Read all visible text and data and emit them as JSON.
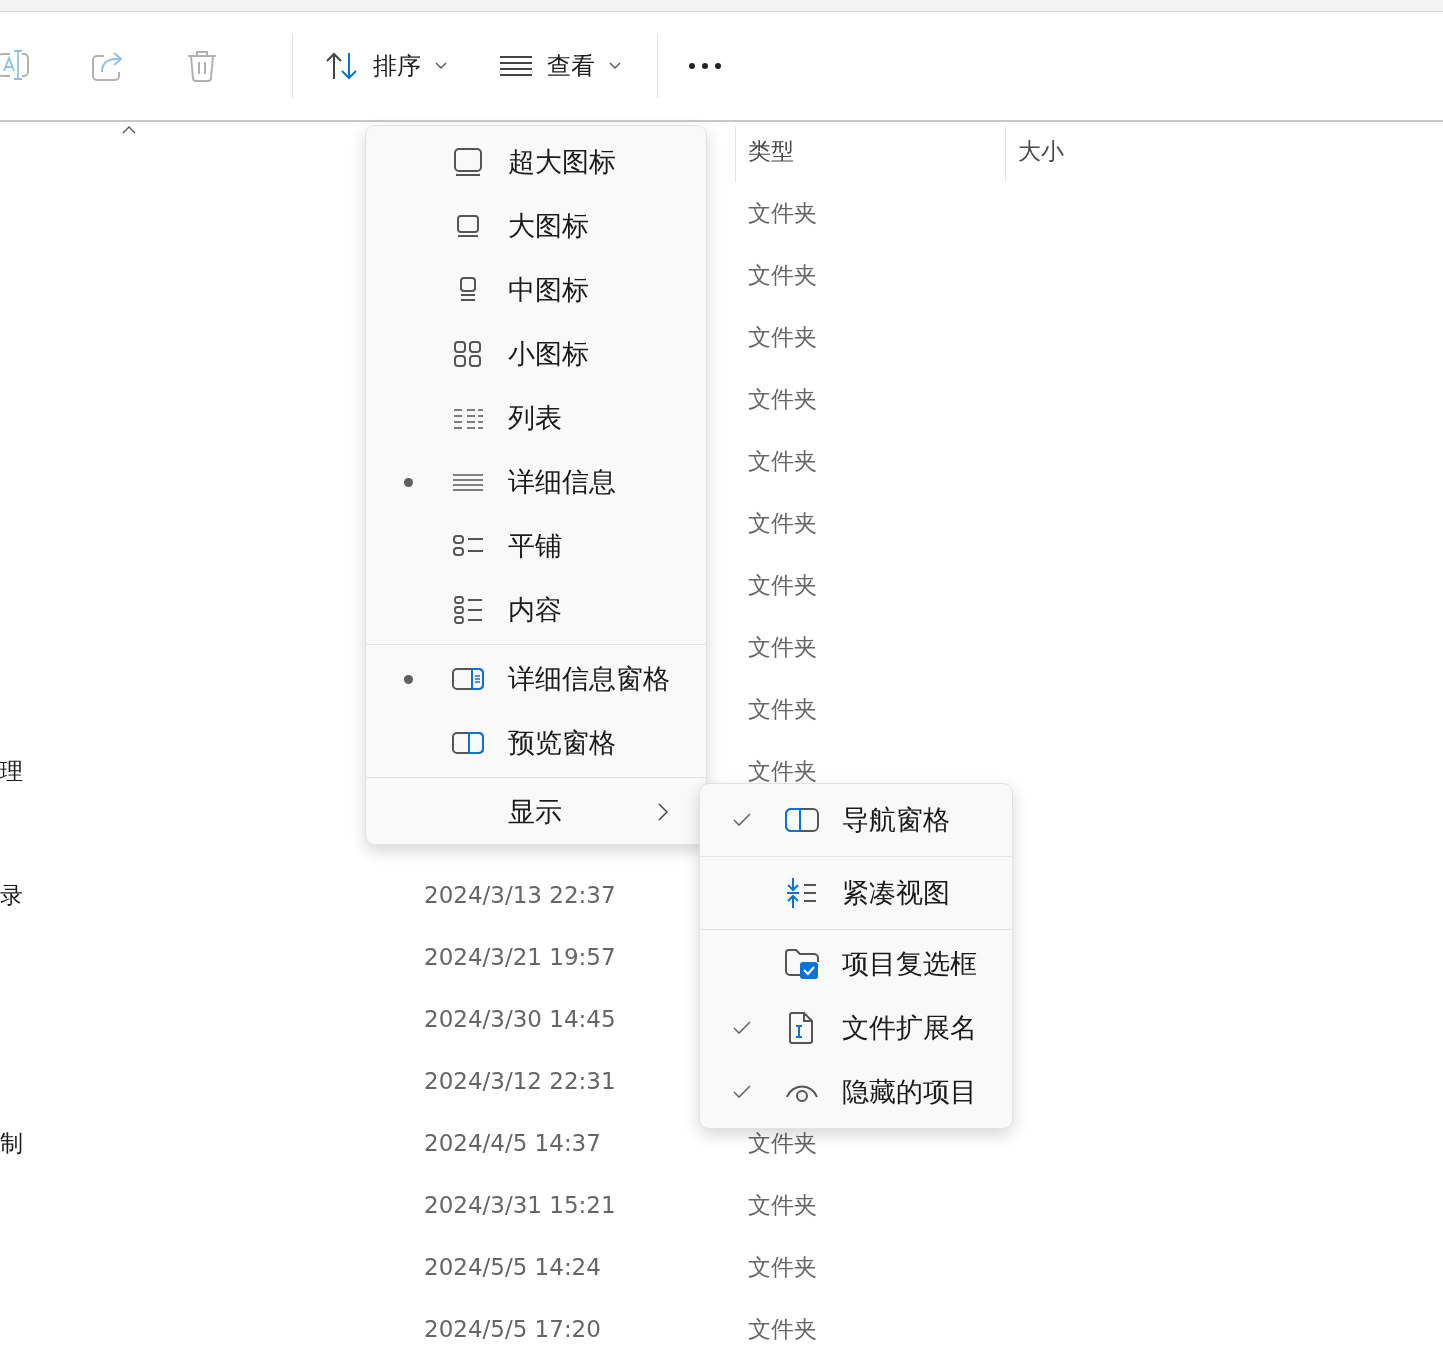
{
  "toolbar": {
    "icon_buttons": [
      {
        "disabled": true
      },
      {
        "disabled": true
      },
      {
        "disabled": true
      }
    ],
    "sort_button": {
      "label": "排序"
    },
    "view_button": {
      "label": "查看"
    }
  },
  "file_list": {
    "columns": [
      {
        "label": "类型"
      },
      {
        "label": "大小"
      }
    ],
    "rows": [
      {
        "type": "文件夹"
      },
      {
        "type": "文件夹"
      },
      {
        "type": "文件夹"
      },
      {
        "type": "文件夹"
      },
      {
        "type": "文件夹"
      },
      {
        "type": "文件夹"
      },
      {
        "type": "文件夹"
      },
      {
        "type": "文件夹"
      },
      {
        "type": "文件夹"
      },
      {
        "name": "理",
        "type": "文件夹"
      },
      {},
      {
        "name": "录",
        "date": "2024/3/13 22:37"
      },
      {
        "date": "2024/3/21 19:57"
      },
      {
        "date": "2024/3/30 14:45"
      },
      {
        "date": "2024/3/12 22:31"
      },
      {
        "name": "制",
        "date": "2024/4/5 14:37",
        "type": "文件夹"
      },
      {
        "date": "2024/3/31 15:21",
        "type": "文件夹"
      },
      {
        "date": "2024/5/5 14:24",
        "type": "文件夹"
      },
      {
        "date": "2024/5/5 17:20",
        "type": "文件夹"
      }
    ]
  },
  "view_menu": {
    "sections": [
      {
        "items": [
          {
            "kind": "option",
            "label": "超大图标",
            "selected": false
          },
          {
            "kind": "option",
            "label": "大图标",
            "selected": false
          },
          {
            "kind": "option",
            "label": "中图标",
            "selected": false
          },
          {
            "kind": "option",
            "label": "小图标",
            "selected": false
          },
          {
            "kind": "option",
            "label": "列表",
            "selected": false
          },
          {
            "kind": "option",
            "label": "详细信息",
            "selected": true
          },
          {
            "kind": "option",
            "label": "平铺",
            "selected": false
          },
          {
            "kind": "option",
            "label": "内容",
            "selected": false
          }
        ]
      },
      {
        "items": [
          {
            "kind": "option",
            "label": "详细信息窗格",
            "selected": true
          },
          {
            "kind": "option",
            "label": "预览窗格",
            "selected": false
          }
        ]
      },
      {
        "items": [
          {
            "kind": "submenu",
            "label": "显示"
          }
        ]
      }
    ]
  },
  "show_menu": {
    "sections": [
      {
        "items": [
          {
            "label": "导航窗格",
            "checked": true
          }
        ]
      },
      {
        "items": [
          {
            "label": "紧凑视图",
            "checked": false
          }
        ]
      },
      {
        "items": [
          {
            "label": "项目复选框",
            "checked": false
          },
          {
            "label": "文件扩展名",
            "checked": true
          },
          {
            "label": "隐藏的项目",
            "checked": true
          }
        ]
      }
    ]
  }
}
